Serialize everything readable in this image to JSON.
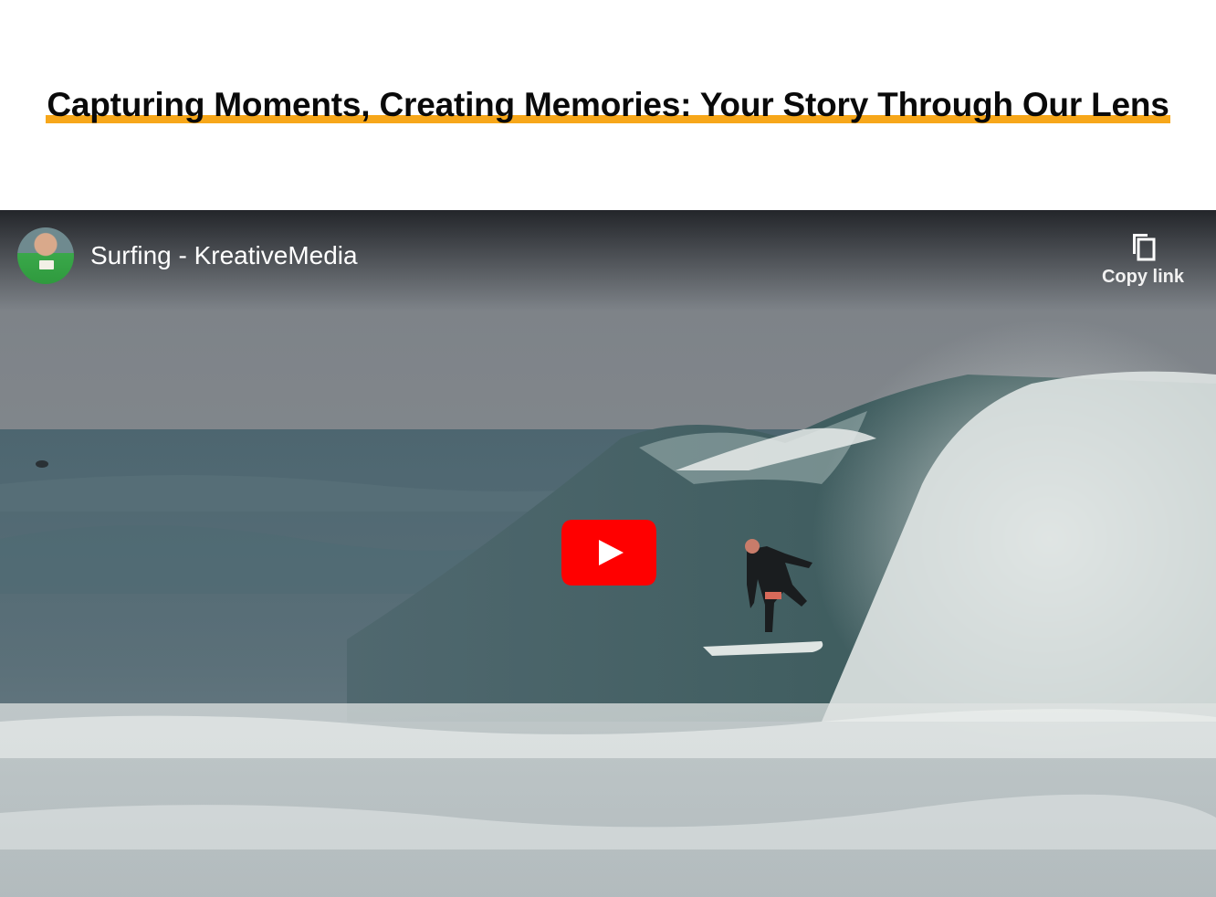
{
  "headline": "Capturing Moments, Creating Memories: Your Story Through Our Lens",
  "video": {
    "title": "Surfing - KreativeMedia",
    "copy_link_label": "Copy link",
    "icons": {
      "copy": "copy-icon",
      "play": "youtube-play-icon"
    }
  },
  "colors": {
    "highlight": "#f7a71a",
    "play_red": "#ff0000",
    "ocean": "#5d6b72"
  }
}
